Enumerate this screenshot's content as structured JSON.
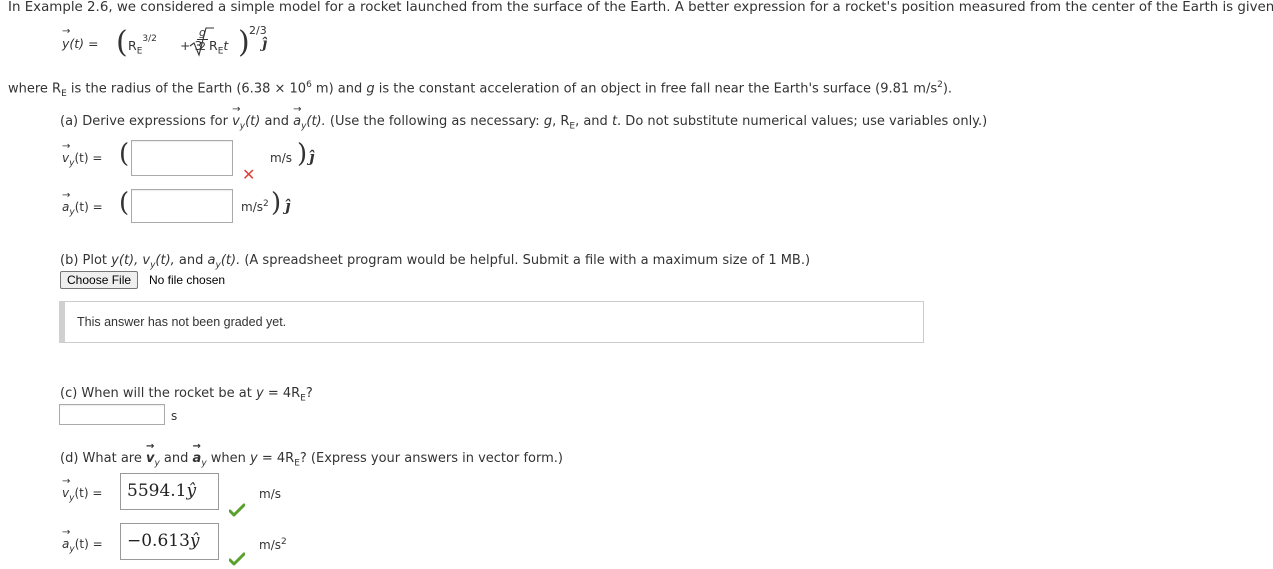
{
  "intro": "In Example 2.6, we considered a simple model for a rocket launched from the surface of the Earth. A better expression for a rocket's position measured from the center of the Earth is given by",
  "equation": {
    "lhs": "y(t) =",
    "re": "R",
    "e_sub": "E",
    "exp32": "3/2",
    "plus": "+ 3",
    "frac_num": "g",
    "frac_den": "2",
    "ret_r": "R",
    "ret_e": "E",
    "ret_t": "t",
    "exp23": "2/3",
    "jhat": "ĵ"
  },
  "where_text": {
    "p1": "where R",
    "sub": "E",
    "p2": " is the radius of the Earth (6.38 × 10",
    "sup6": "6",
    "p3": " m) and ",
    "g": "g",
    "p4": " is the constant acceleration of an object in free fall near the Earth's surface (9.81 m/s",
    "sup2": "2",
    "p5": ")."
  },
  "part_a": {
    "prompt": {
      "p1": "(a) Derive expressions for ",
      "v": "v",
      "vsub": "y",
      "t1": "(t)",
      "and": " and ",
      "a": "a",
      "asub": "y",
      "t2": "(t).",
      "p2": " (Use the following as necessary: ",
      "g": "g",
      "comma": ", R",
      "esub": "E",
      "comma2": ", and ",
      "t": "t",
      "p3": ". Do not substitute numerical values; use variables only.)"
    },
    "v_label": {
      "sym": "v",
      "sub": "y",
      "rest": "(t) ="
    },
    "v_unit": "m/s",
    "v_value": "",
    "a_label": {
      "sym": "a",
      "sub": "y",
      "rest": "(t) ="
    },
    "a_unit": "m/s",
    "a_unit_sup": "2",
    "a_value": "",
    "jhat": "ĵ"
  },
  "part_b": {
    "prompt": {
      "p1": "(b) Plot ",
      "y": "y",
      "t1": "(t),  ",
      "v": "v",
      "vsub": "y",
      "t2": "(t),",
      "and": " and ",
      "a": "a",
      "asub": "y",
      "t3": "(t).",
      "p2": " (A spreadsheet program would be helpful. Submit a file with a maximum size of 1 MB.)"
    },
    "choose_file": "Choose File",
    "no_file": "No file chosen",
    "graded_msg": "This answer has not been graded yet."
  },
  "part_c": {
    "prompt": {
      "p1": "(c) When will the rocket be at ",
      "y": "y",
      "p2": " = 4R",
      "esub": "E",
      "p3": "?"
    },
    "value": "",
    "unit": "s"
  },
  "part_d": {
    "prompt": {
      "p1": "(d) What are ",
      "v": "v",
      "vsub": "y",
      "and": " and ",
      "a": "a",
      "asub": "y",
      "when": " when ",
      "y": "y",
      "p2": " = 4R",
      "esub": "E",
      "p3": "? (Express your answers in vector form.)"
    },
    "v_label": {
      "sym": "v",
      "sub": "y",
      "rest": "(t)  ="
    },
    "v_value": "5594.1",
    "v_hat": "ŷ",
    "v_unit": "m/s",
    "a_label": {
      "sym": "a",
      "sub": "y",
      "rest": "(t)  ="
    },
    "a_value": "−0.613",
    "a_hat": "ŷ",
    "a_unit": "m/s",
    "a_unit_sup": "2"
  },
  "colors": {
    "correct": "#5aa02c",
    "incorrect": "#e0443a",
    "text": "#333333"
  }
}
